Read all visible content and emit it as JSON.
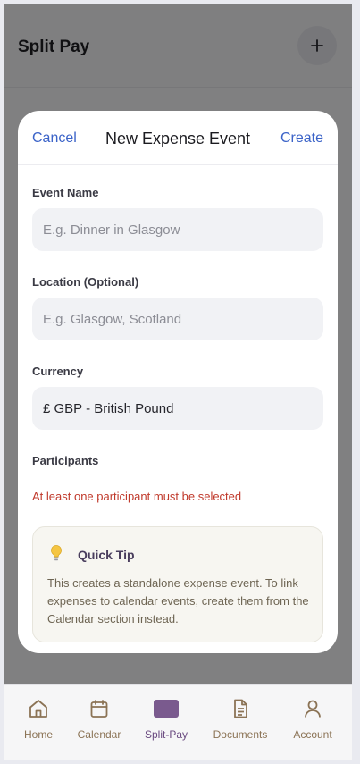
{
  "app": {
    "title": "Split Pay",
    "add_icon": "plus-icon"
  },
  "modal": {
    "cancel_label": "Cancel",
    "title": "New Expense Event",
    "create_label": "Create",
    "event_name": {
      "label": "Event Name",
      "value": "",
      "placeholder": "E.g. Dinner in Glasgow"
    },
    "location": {
      "label": "Location (Optional)",
      "value": "",
      "placeholder": "E.g. Glasgow, Scotland"
    },
    "currency": {
      "label": "Currency",
      "value": "£ GBP - British Pound"
    },
    "participants": {
      "label": "Participants",
      "error": "At least one participant must be selected"
    },
    "tip": {
      "icon": "lightbulb-icon",
      "title": "Quick Tip",
      "body": "This creates a standalone expense event. To link expenses to calendar events, create them from the Calendar section instead."
    }
  },
  "tabbar": {
    "items": [
      {
        "label": "Home",
        "icon": "home-icon",
        "active": false
      },
      {
        "label": "Calendar",
        "icon": "calendar-icon",
        "active": false
      },
      {
        "label": "Split-Pay",
        "icon": "split-pay-icon",
        "active": true
      },
      {
        "label": "Documents",
        "icon": "document-icon",
        "active": false
      },
      {
        "label": "Account",
        "icon": "user-icon",
        "active": false
      }
    ]
  },
  "colors": {
    "accent_link": "#3b63c8",
    "error": "#c0392b",
    "tab_inactive": "#8b7355",
    "tab_active": "#6a4a80",
    "tip_title": "#4a3e5e"
  }
}
